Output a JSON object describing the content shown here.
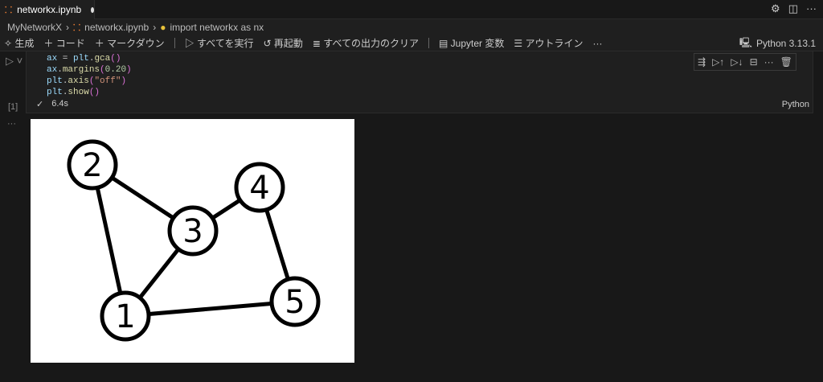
{
  "tab": {
    "title": "networkx.ipynb",
    "dirty": true
  },
  "breadcrumb": [
    "MyNetworkX",
    "networkx.ipynb",
    "import networkx as nx"
  ],
  "toolbar": {
    "generate": "生成",
    "code": "コード",
    "markdown": "マークダウン",
    "run_all": "すべてを実行",
    "restart": "再起動",
    "clear": "すべての出力のクリア",
    "variables": "Jupyter 変数",
    "outline": "アウトライン",
    "more": "···",
    "kernel": "Python 3.13.1"
  },
  "cell": {
    "exec_count": "[1]",
    "time": "6.4s",
    "language": "Python",
    "output_more": "···",
    "code": [
      [
        "ax",
        " = ",
        "plt",
        ".",
        "gca",
        "()"
      ],
      [
        "ax",
        ".",
        "margins",
        "(",
        "0.20",
        ")"
      ],
      [
        "plt",
        ".",
        "axis",
        "(",
        "\"off\"",
        ")"
      ],
      [
        "plt",
        ".",
        "show",
        "()"
      ]
    ]
  },
  "graph": {
    "nodes": [
      "1",
      "2",
      "3",
      "4",
      "5"
    ],
    "edges": [
      [
        "1",
        "2"
      ],
      [
        "1",
        "3"
      ],
      [
        "2",
        "3"
      ],
      [
        "3",
        "4"
      ],
      [
        "4",
        "5"
      ],
      [
        "1",
        "5"
      ]
    ]
  }
}
